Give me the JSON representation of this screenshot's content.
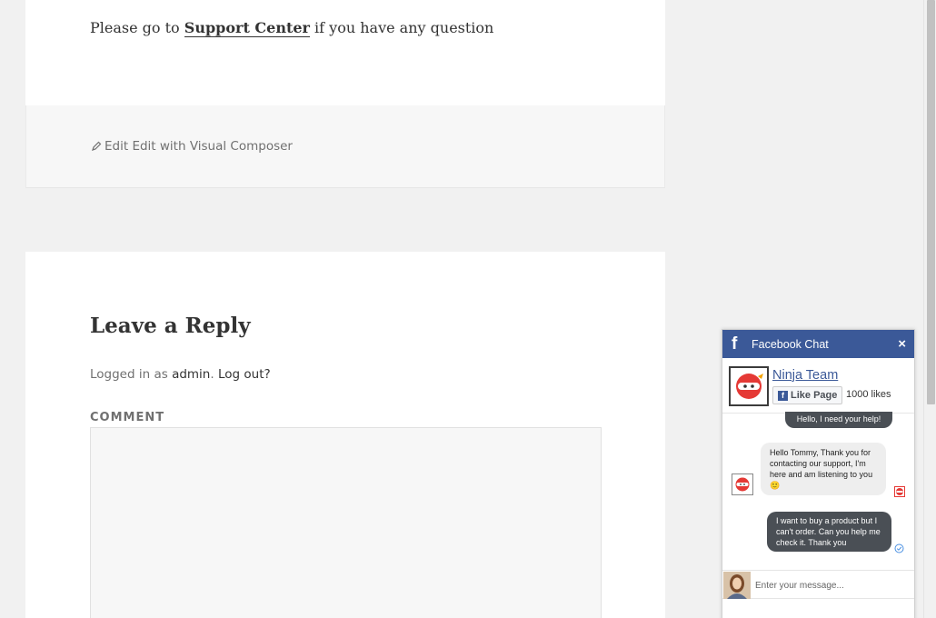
{
  "article": {
    "support_prefix": "Please go to",
    "support_link": "Support Center",
    "support_suffix": "if you have any question"
  },
  "footer": {
    "edit_label": "Edit",
    "edit_vc_label": "Edit with Visual Composer"
  },
  "reply": {
    "title": "Leave a Reply",
    "logged_prefix": "Logged in as",
    "user": "admin",
    "logout": "Log out?",
    "comment_label": "COMMENT"
  },
  "fb_chat": {
    "title": "Facebook Chat",
    "close": "×",
    "page_name": "Ninja Team",
    "like_label": "Like Page",
    "likes": "1000 likes",
    "messages": [
      {
        "direction": "out",
        "text": "Hello, I need your help!"
      },
      {
        "direction": "in",
        "text": "Hello Tommy, Thank you for contacting our support, I'm here and am listening to you 🙂"
      },
      {
        "direction": "out",
        "text": "I want to buy a product but I can't order. Can you help me check it. Thank you"
      }
    ],
    "input_placeholder": "Enter your message..."
  },
  "colors": {
    "fb_blue": "#3b5998",
    "bubble_out": "#4a4f55",
    "bubble_in": "#eeeeee",
    "ninja_red": "#e53935"
  }
}
